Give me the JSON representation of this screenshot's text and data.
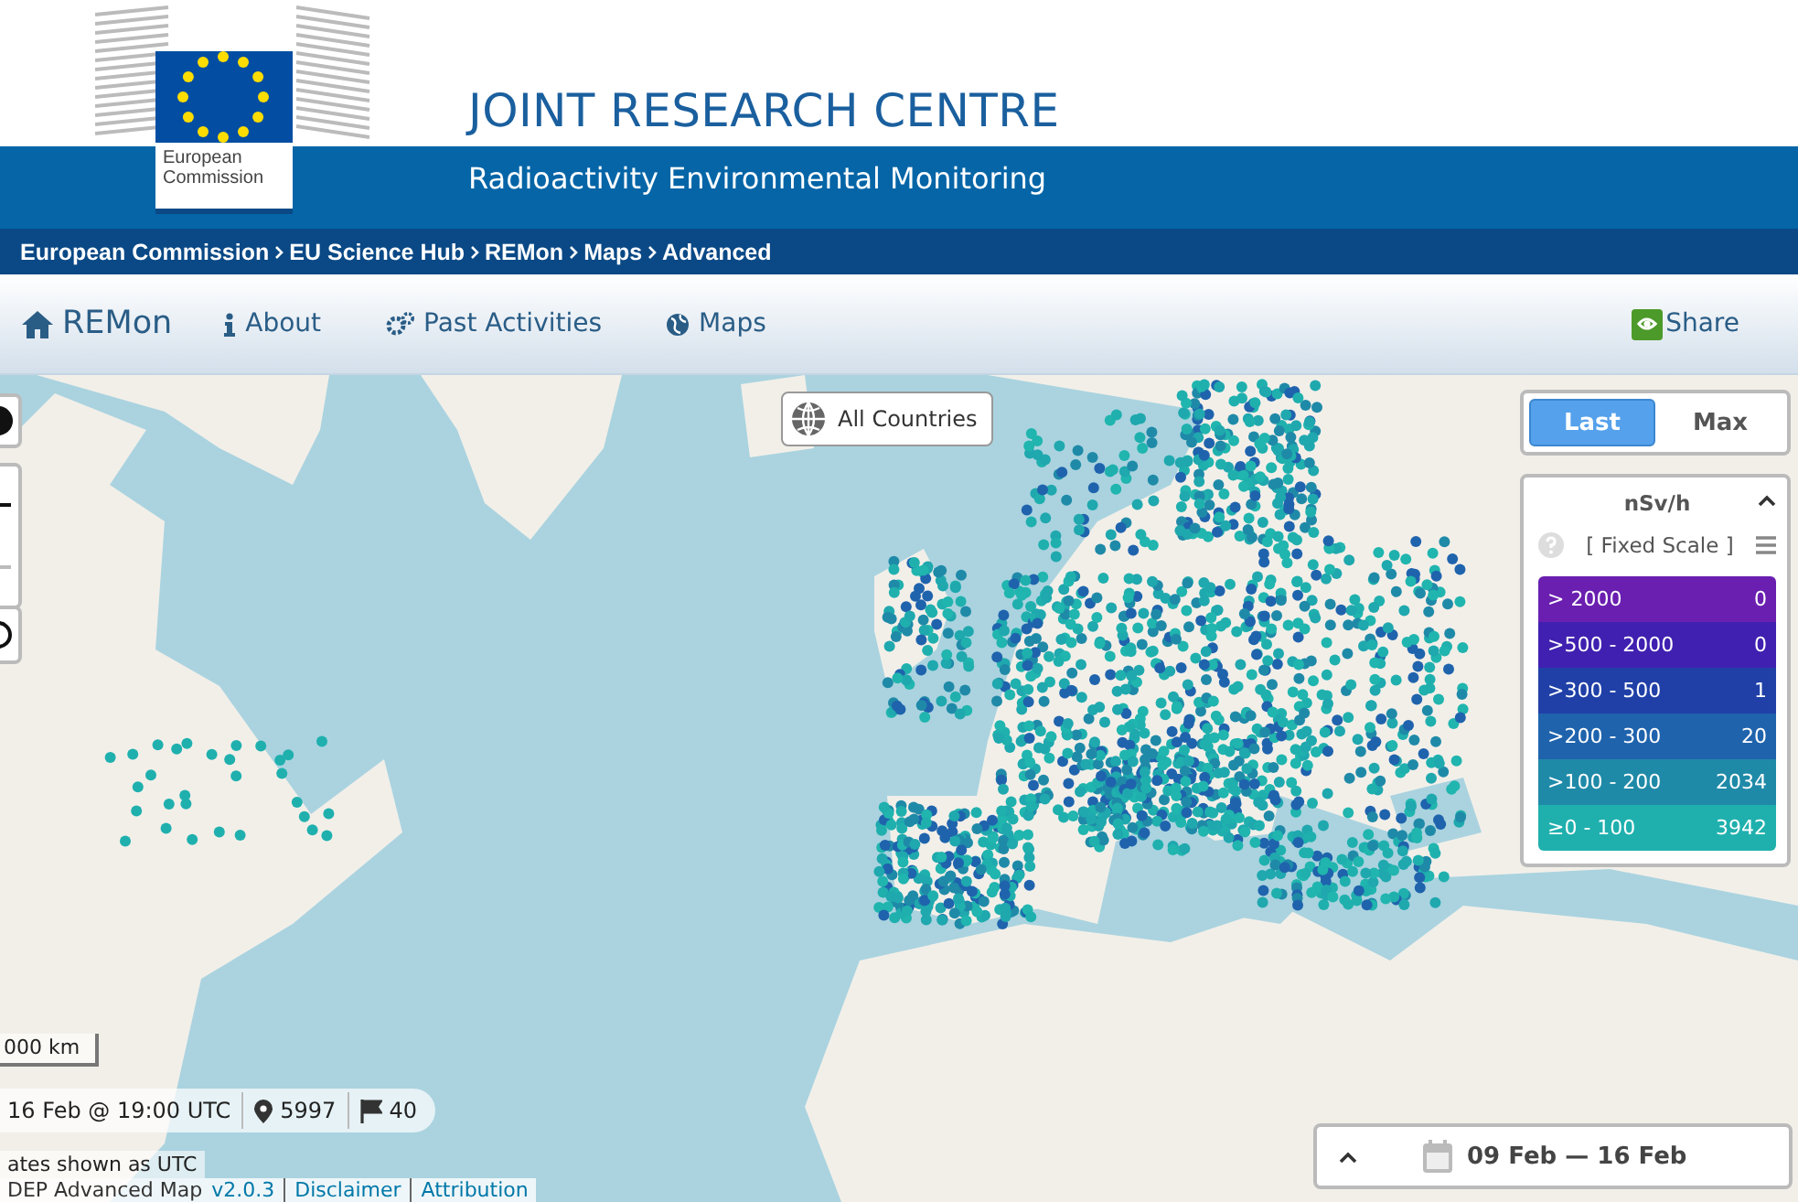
{
  "header": {
    "logo_text": "European Commission",
    "title": "JOINT RESEARCH CENTRE",
    "subtitle": "Radioactivity Environmental Monitoring"
  },
  "breadcrumb": [
    "European Commission",
    "EU Science Hub",
    "REMon",
    "Maps",
    "Advanced"
  ],
  "nav": {
    "brand": "REMon",
    "items": [
      {
        "label": "About"
      },
      {
        "label": "Past Activities"
      },
      {
        "label": "Maps"
      }
    ],
    "share": "Share"
  },
  "map": {
    "region_button": "All Countries",
    "modes": [
      {
        "label": "Last",
        "selected": true
      },
      {
        "label": "Max",
        "selected": false
      }
    ],
    "legend": {
      "unit": "nSv/h",
      "expanded": true,
      "scale": "[ Fixed Scale ]",
      "classes": [
        {
          "range": "> 2000",
          "count": "0",
          "color": "#6a1fb0"
        },
        {
          "range": ">500 - 2000",
          "count": "0",
          "color": "#4020b0"
        },
        {
          "range": ">300 - 500",
          "count": "1",
          "color": "#2040a8"
        },
        {
          "range": ">200 - 300",
          "count": "20",
          "color": "#1f63ad"
        },
        {
          "range": ">100 - 200",
          "count": "2034",
          "color": "#1f8aa8"
        },
        {
          "range": "≥0 - 100",
          "count": "3942",
          "color": "#1fb0ae"
        }
      ]
    },
    "scale_label": "000 km",
    "status": {
      "time": "16 Feb @ 19:00 UTC",
      "stations": "5997",
      "countries": "40"
    },
    "utc_note": "ates shown as UTC",
    "footer": {
      "name": "DEP Advanced Map",
      "version": "v2.0.3",
      "links": [
        "Disclaimer",
        "Attribution"
      ]
    },
    "period": {
      "range": "09 Feb — 16 Feb",
      "expanded": false
    }
  }
}
